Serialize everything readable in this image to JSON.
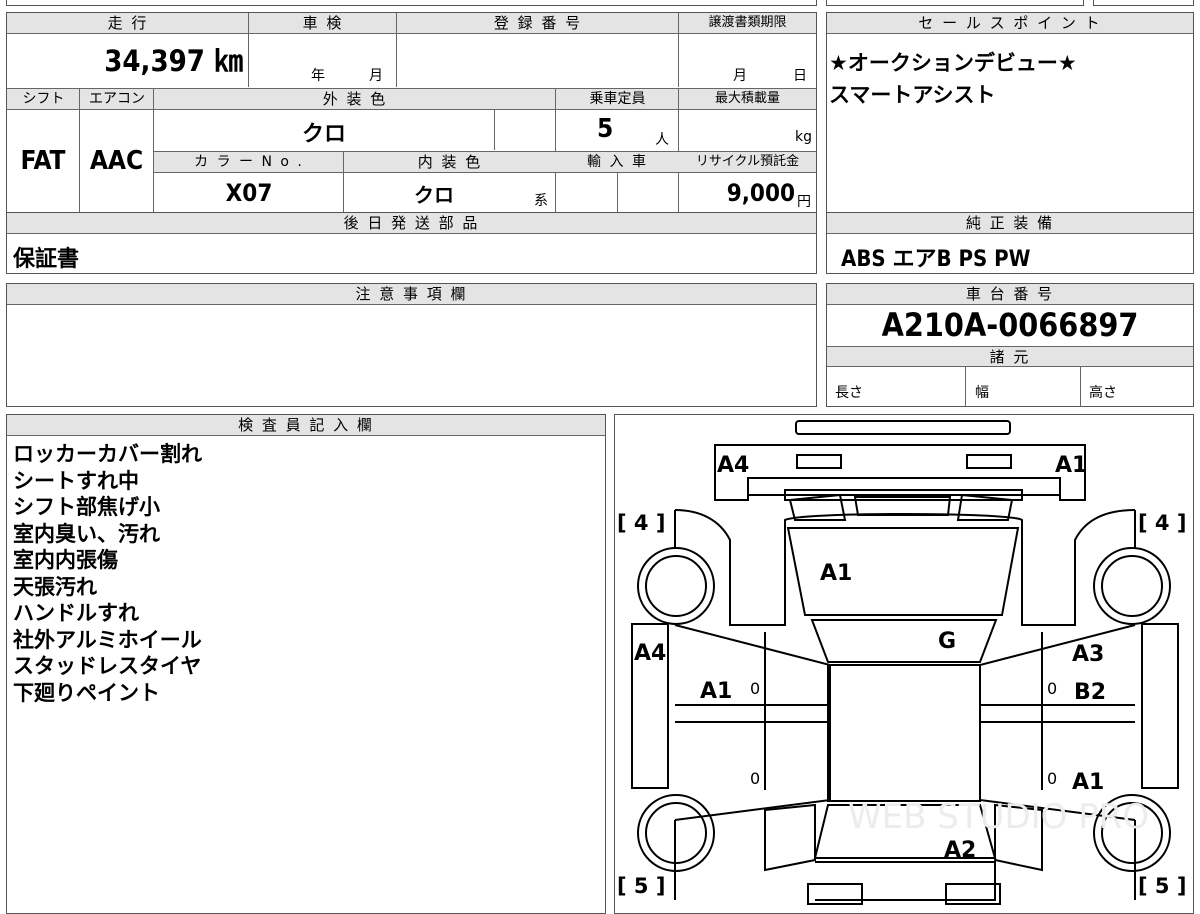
{
  "vehicle": {
    "mileage_label": "走 行",
    "mileage": "34,397 ㎞",
    "inspection_label": "車 検",
    "inspection_year_unit": "年",
    "inspection_month_unit": "月",
    "registration_label": "登 録 番 号",
    "transfer_deadline_label": "譲渡書類期限",
    "transfer_month_unit": "月",
    "transfer_day_unit": "日",
    "shift_label": "シフト",
    "shift": "FAT",
    "aircon_label": "エアコン",
    "aircon": "AAC",
    "exterior_color_label": "外 装 色",
    "exterior_color": "クロ",
    "capacity_label": "乗車定員",
    "capacity": "5",
    "capacity_unit": "人",
    "max_load_label": "最大積載量",
    "max_load_unit": "kg",
    "color_no_label": "カ ラ ー N o .",
    "color_no": "X07",
    "interior_color_label": "内 装 色",
    "interior_color": "クロ",
    "interior_color_suffix": "系",
    "import_label": "輸 入 車",
    "recycle_label": "リサイクル預託金",
    "recycle_fee": "9,000",
    "recycle_unit": "円"
  },
  "later_parts": {
    "label": "後 日 発 送 部 品",
    "value": "保証書"
  },
  "notes": {
    "label": "注 意 事 項 欄"
  },
  "sales_points": {
    "label": "セ ー ル ス ポ イ ン ト",
    "lines": [
      "★オークションデビュー★",
      "スマートアシスト"
    ]
  },
  "equipment": {
    "label": "純 正 装 備",
    "value": "ABS エアB PS PW"
  },
  "chassis": {
    "label": "車 台 番 号",
    "number": "A210A-0066897"
  },
  "specs": {
    "label": "諸 元",
    "length_label": "長さ",
    "width_label": "幅",
    "height_label": "高さ"
  },
  "inspector": {
    "label": "検 査 員 記 入 欄",
    "lines": [
      "ロッカーカバー割れ",
      "シートすれ中",
      "シフト部焦げ小",
      "室内臭い、汚れ",
      "室内内張傷",
      "天張汚れ",
      "ハンドルすれ",
      "社外アルミホイール",
      "スタッドレスタイヤ",
      "下廻りペイント"
    ]
  },
  "diagram": {
    "marks": {
      "front_left_corner": "A4",
      "front_right_corner": "A1",
      "windshield": "A1",
      "roof": "G",
      "left_front_door": "A4",
      "left_door_center": "A1",
      "right_front_door_a": "A3",
      "right_front_door_b": "B2",
      "right_rear_door": "A1",
      "rear": "A2",
      "left_front_tire": "[ 4 ]",
      "right_front_tire": "[ 4 ]",
      "left_rear_tire": "[ 5 ]",
      "right_rear_tire": "[ 5 ]",
      "pillar_left_upper": "0",
      "pillar_left_lower": "0",
      "pillar_right_upper": "0",
      "pillar_right_lower": "0"
    },
    "watermark": "WEB STUDIO PRO"
  }
}
